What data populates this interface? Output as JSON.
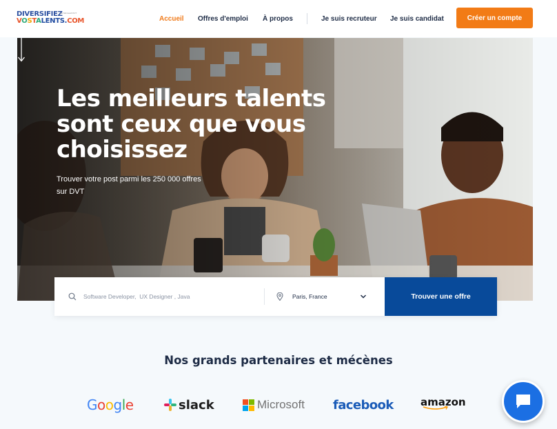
{
  "header": {
    "logo_line1": "DIVERSIFIEZ",
    "logo_line2": "VOSTALENTS.COM",
    "logo_tagline": "par Microsoft DVT",
    "nav": {
      "accueil": "Accueil",
      "offres": "Offres d'emploi",
      "propos": "À propos",
      "recruteur": "Je suis recruteur",
      "candidat": "Je suis candidat"
    },
    "cta_label": "Créer un compte"
  },
  "hero": {
    "title_lines": [
      "Les meilleurs talents",
      "sont ceux que vous",
      "choisissez"
    ],
    "subtitle": "Trouver votre post parmi les 250 000 offres sur DVT"
  },
  "search": {
    "placeholder": "Software Developer,  UX Designer , Java",
    "location": "Paris, France",
    "button_label": "Trouver une offre"
  },
  "partners": {
    "title": "Nos grands partenaires et mécènes",
    "logos": [
      "Google",
      "slack",
      "Microsoft",
      "facebook",
      "amazon"
    ]
  },
  "colors": {
    "accent": "#f27b16",
    "primary": "#084a9a",
    "text": "#1d2b45"
  },
  "icons": [
    "search-icon",
    "location-pin-icon",
    "chevron-down-icon",
    "arrow-down-icon",
    "chat-icon"
  ]
}
